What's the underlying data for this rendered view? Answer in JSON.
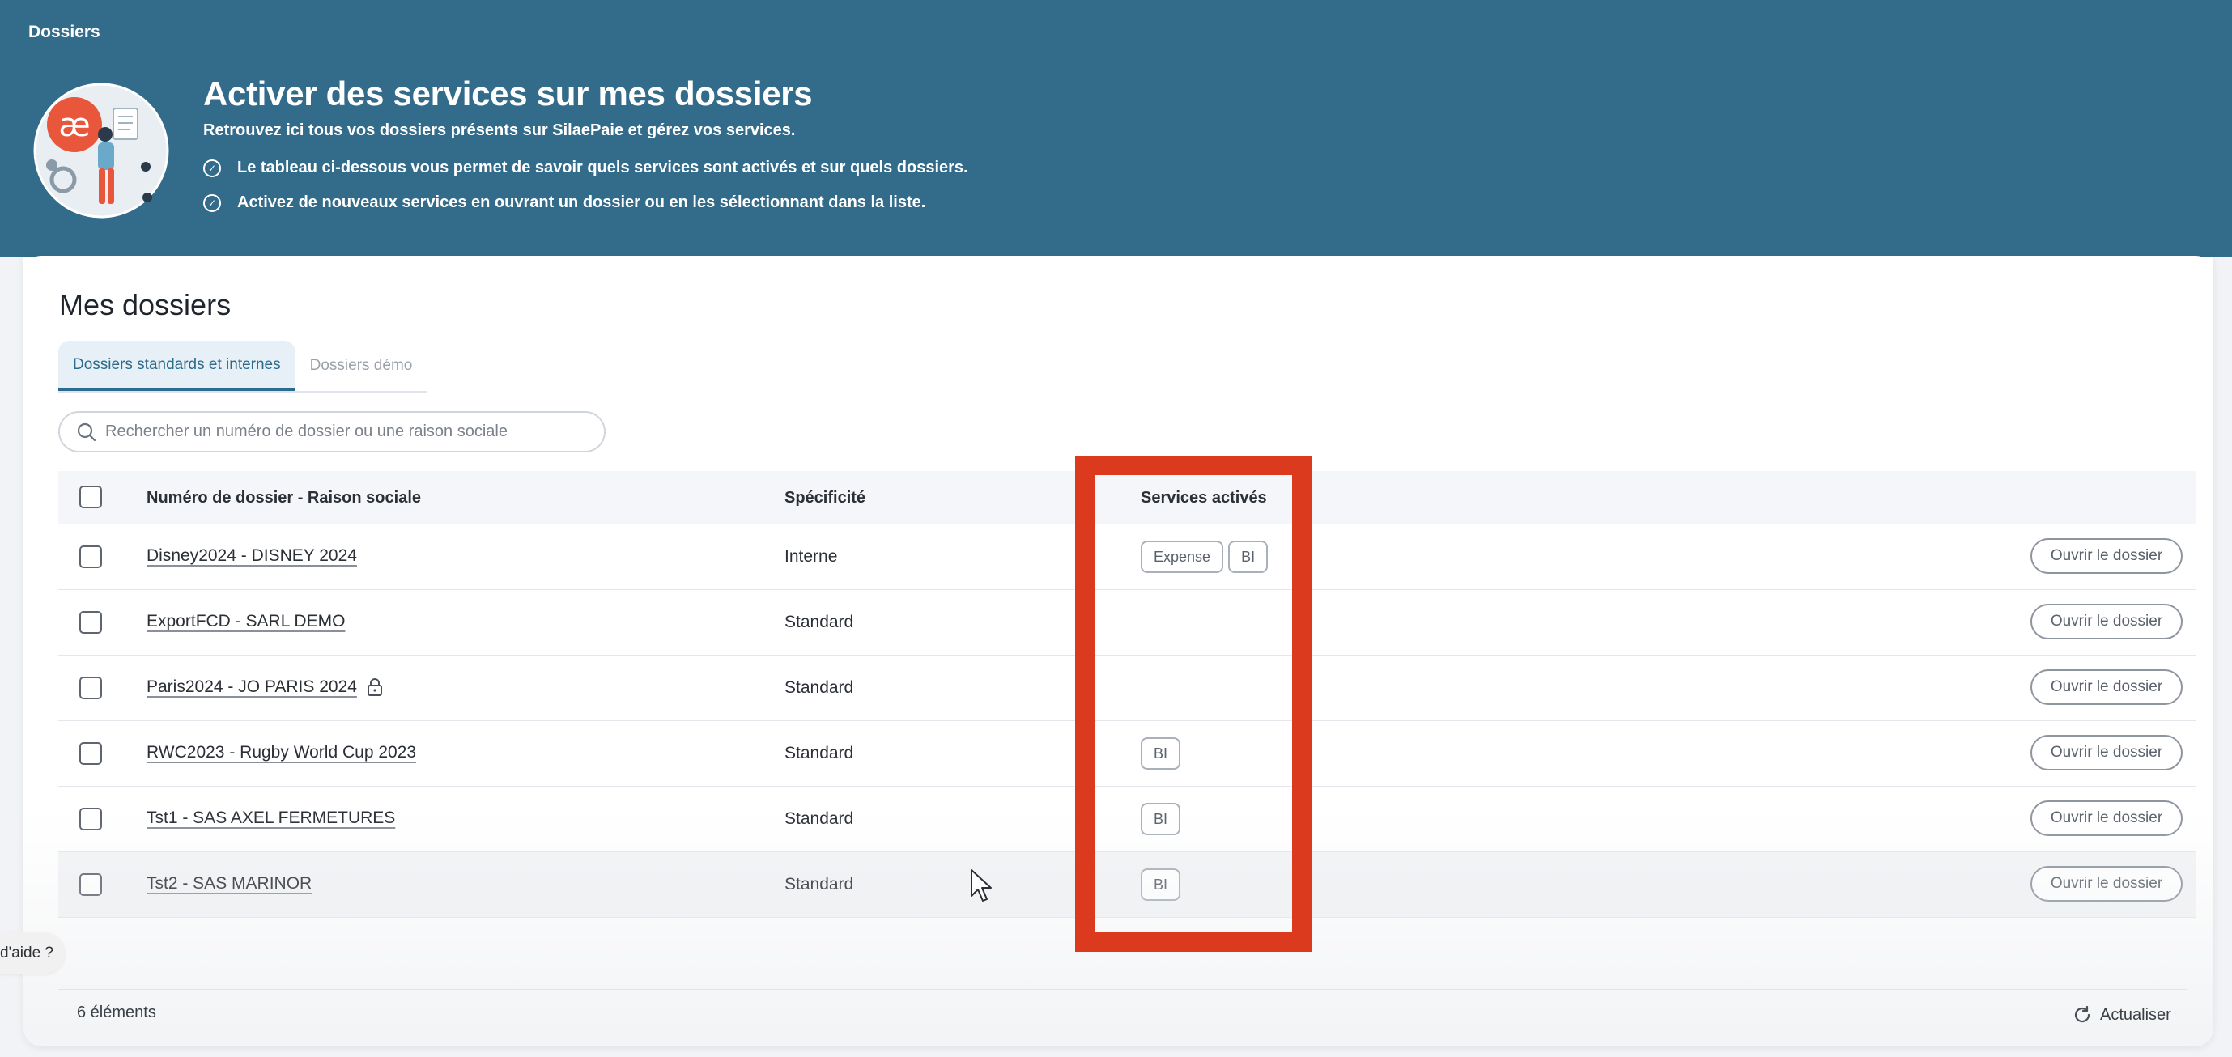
{
  "header": {
    "breadcrumb": "Dossiers",
    "title": "Activer des services sur mes dossiers",
    "subtitle": "Retrouvez ici tous vos dossiers présents sur SilaePaie et gérez vos services.",
    "bullets": [
      "Le tableau ci-dessous vous permet de savoir quels services sont activés et sur quels dossiers.",
      "Activez de nouveaux services en ouvrant un dossier ou en les sélectionnant dans la liste."
    ],
    "logo_text": "æ"
  },
  "section": {
    "title": "Mes dossiers",
    "tabs": [
      {
        "label": "Dossiers standards et internes",
        "active": true
      },
      {
        "label": "Dossiers démo",
        "active": false
      }
    ]
  },
  "search": {
    "placeholder": "Rechercher un numéro de dossier ou une raison sociale"
  },
  "table": {
    "columns": [
      "Numéro de dossier - Raison sociale",
      "Spécificité",
      "Services activés"
    ],
    "action_label": "Ouvrir le dossier",
    "rows": [
      {
        "name": "Disney2024 - DISNEY 2024",
        "spec": "Interne",
        "services": [
          "Expense",
          "BI"
        ],
        "locked": false
      },
      {
        "name": "ExportFCD - SARL DEMO",
        "spec": "Standard",
        "services": [],
        "locked": false
      },
      {
        "name": "Paris2024 - JO PARIS 2024",
        "spec": "Standard",
        "services": [],
        "locked": true
      },
      {
        "name": "RWC2023 - Rugby World Cup 2023",
        "spec": "Standard",
        "services": [
          "BI"
        ],
        "locked": false
      },
      {
        "name": "Tst1 - SAS AXEL FERMETURES",
        "spec": "Standard",
        "services": [
          "BI"
        ],
        "locked": false
      },
      {
        "name": "Tst2 - SAS MARINOR",
        "spec": "Standard",
        "services": [
          "BI"
        ],
        "locked": false
      }
    ]
  },
  "footer": {
    "count": "6 éléments",
    "refresh_label": "Actualiser"
  },
  "help": {
    "label": "Besoin d'aide ?"
  },
  "colors": {
    "banner": "#336b8a",
    "highlight": "#dc3a1e",
    "accent": "#2d6b8d"
  },
  "icons": [
    "check-circle-icon",
    "search-icon",
    "lock-icon",
    "refresh-icon"
  ]
}
